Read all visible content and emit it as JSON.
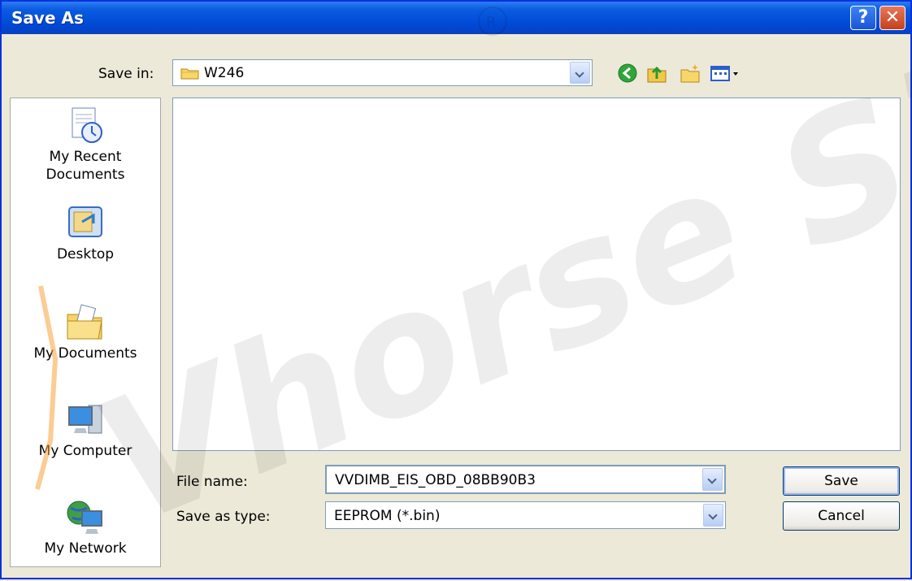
{
  "window": {
    "title": "Save As"
  },
  "titlebar": {
    "help": "?",
    "close": "✕"
  },
  "save_in": {
    "label": "Save in:",
    "value": "W246"
  },
  "toolbar": {
    "back_icon": "back-arrow-icon",
    "up_icon": "up-folder-icon",
    "new_folder_icon": "new-folder-icon",
    "views_icon": "views-menu-icon"
  },
  "places": [
    {
      "label": "My Recent\nDocuments",
      "icon": "recent-documents-icon"
    },
    {
      "label": "Desktop",
      "icon": "desktop-icon"
    },
    {
      "label": "My Documents",
      "icon": "my-documents-icon"
    },
    {
      "label": "My Computer",
      "icon": "my-computer-icon"
    },
    {
      "label": "My Network",
      "icon": "my-network-icon"
    }
  ],
  "file_name": {
    "label": "File name:",
    "value": "VVDIMB_EIS_OBD_08BB90B3"
  },
  "save_as_type": {
    "label": "Save as type:",
    "value": "EEPROM (*.bin)"
  },
  "buttons": {
    "save": "Save",
    "cancel": "Cancel"
  },
  "watermark": {
    "text": "Vhorse Site",
    "mark": "®"
  }
}
